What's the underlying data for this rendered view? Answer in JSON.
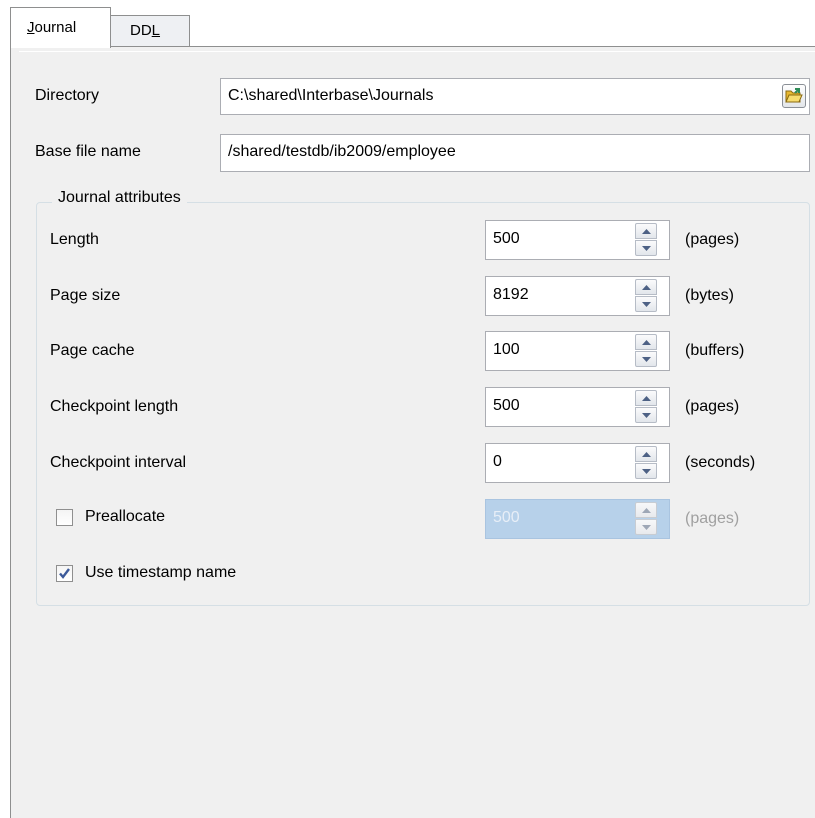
{
  "tabs": [
    {
      "label": "Journal",
      "mnemonic": "J",
      "rest": "ournal",
      "active": true
    },
    {
      "label": "DDL",
      "prefix": "DD",
      "mnemonic": "L",
      "active": false
    }
  ],
  "directory": {
    "label": "Directory",
    "value": "C:\\shared\\Interbase\\Journals"
  },
  "base_file": {
    "label": "Base file name",
    "value": "/shared/testdb/ib2009/employee"
  },
  "journal_attributes": {
    "title": "Journal attributes",
    "fields": [
      {
        "label": "Length",
        "value": "500",
        "unit": "(pages)",
        "enabled": true
      },
      {
        "label": "Page size",
        "value": "8192",
        "unit": "(bytes)",
        "enabled": true
      },
      {
        "label": "Page cache",
        "value": "100",
        "unit": "(buffers)",
        "enabled": true
      },
      {
        "label": "Checkpoint length",
        "value": "500",
        "unit": "(pages)",
        "enabled": true
      },
      {
        "label": "Checkpoint interval",
        "value": "0",
        "unit": "(seconds)",
        "enabled": true
      }
    ],
    "preallocate": {
      "label": "Preallocate",
      "checked": false,
      "value": "500",
      "unit": "(pages)",
      "enabled": false
    },
    "use_timestamp": {
      "label": "Use timestamp name",
      "checked": true
    }
  },
  "icons": {
    "browse": "open-folder-icon",
    "spin_up": "spin-up-arrow-icon",
    "spin_down": "spin-down-arrow-icon",
    "check": "checkmark-icon"
  },
  "colors": {
    "panel_bg": "#f0f0f0",
    "field_border": "#abadb3",
    "disabled_field": "#b7d1ea",
    "check_mark": "#3c5a9a"
  }
}
